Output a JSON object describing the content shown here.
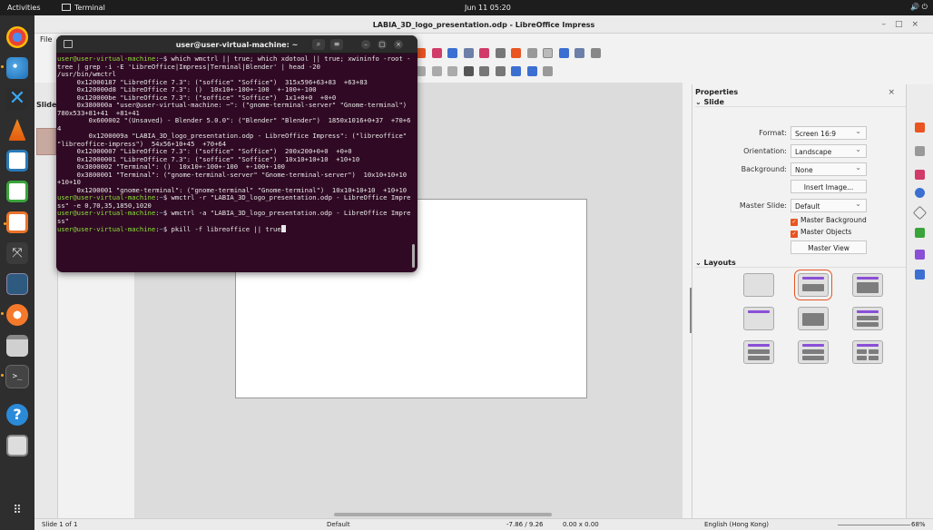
{
  "topbar": {
    "activities": "Activities",
    "app_name": "Terminal",
    "clock": "Jun 11  05:20",
    "sys_icons": "🔊  ⏻"
  },
  "window": {
    "title": "LABIA_3D_logo_presentation.odp - LibreOffice Impress",
    "menu_file": "File",
    "slides_label": "Slide"
  },
  "terminal": {
    "title": "user@user-virtual-machine: ~",
    "prompt_user": "user@user-virtual-machine",
    "prompt_path": "~",
    "lines": [
      {
        "type": "cmd",
        "text": "which wmctrl || true; which xdotool || true; xwininfo -root -tree | grep -i -E 'LibreOffice|Impress|Terminal|Blender' | head -20"
      },
      {
        "type": "out",
        "text": "/usr/bin/wmctrl"
      },
      {
        "type": "out",
        "text": "     0x12000187 \"LibreOffice 7.3\": (\"soffice\" \"Soffice\")  315x596+63+83  +63+83"
      },
      {
        "type": "out",
        "text": "     0x120000d8 \"LibreOffice 7.3\": ()  10x10+-100+-100  +-100+-100"
      },
      {
        "type": "out",
        "text": "     0x120000be \"LibreOffice 7.3\": (\"soffice\" \"Soffice\")  1x1+0+0  +0+0"
      },
      {
        "type": "out",
        "text": "     0x380000a \"user@user-virtual-machine: ~\": (\"gnome-terminal-server\" \"Gnome-terminal\")  780x533+81+41  +81+41"
      },
      {
        "type": "out",
        "text": "        0x600002 \"(Unsaved) - Blender 5.0.0\": (\"Blender\" \"Blender\")  1850x1016+0+37  +70+64"
      },
      {
        "type": "out",
        "text": "        0x1200009a \"LABIA_3D_logo_presentation.odp - LibreOffice Impress\": (\"libreoffice\" \"libreoffice-impress\")  54x56+10+45  +70+64"
      },
      {
        "type": "out",
        "text": "     0x12000007 \"LibreOffice 7.3\": (\"soffice\" \"Soffice\")  200x200+0+0  +0+0"
      },
      {
        "type": "out",
        "text": "     0x12000001 \"LibreOffice 7.3\": (\"soffice\" \"Soffice\")  10x10+10+10  +10+10"
      },
      {
        "type": "out",
        "text": "     0x3800002 \"Terminal\": ()  10x10+-100+-100  +-100+-100"
      },
      {
        "type": "out",
        "text": "     0x3800001 \"Terminal\": (\"gnome-terminal-server\" \"Gnome-terminal-server\")  10x10+10+10  +10+10"
      },
      {
        "type": "out",
        "text": "     0x1200001 \"gnome-terminal\": (\"gnome-terminal\" \"Gnome-terminal\")  10x10+10+10  +10+10"
      },
      {
        "type": "cmd",
        "text": "wmctrl -r \"LABIA_3D_logo_presentation.odp - LibreOffice Impress\" -e 0,70,35,1850,1020"
      },
      {
        "type": "cmd",
        "text": "wmctrl -a \"LABIA_3D_logo_presentation.odp - LibreOffice Impress\""
      },
      {
        "type": "cmd_active",
        "text": "pkill -f libreoffice || true"
      }
    ]
  },
  "properties": {
    "title": "Properties",
    "section_slide": "Slide",
    "format_label": "Format:",
    "format_value": "Screen 16:9",
    "orientation_label": "Orientation:",
    "orientation_value": "Landscape",
    "background_label": "Background:",
    "background_value": "None",
    "insert_image": "Insert Image...",
    "master_slide_label": "Master Slide:",
    "master_slide_value": "Default",
    "master_background": "Master Background",
    "master_objects": "Master Objects",
    "master_view": "Master View",
    "section_layouts": "Layouts"
  },
  "statusbar": {
    "slide_of": "Slide 1 of 1",
    "master": "Default",
    "position": "-7.86 / 9.26",
    "size": "0.00 x 0.00",
    "language": "English (Hong Kong)",
    "zoom": "68%"
  },
  "colors": {
    "accent": "#e95420",
    "terminal_bg": "#300a24",
    "prompt_user": "#8ae234",
    "prompt_path": "#729fcf"
  }
}
